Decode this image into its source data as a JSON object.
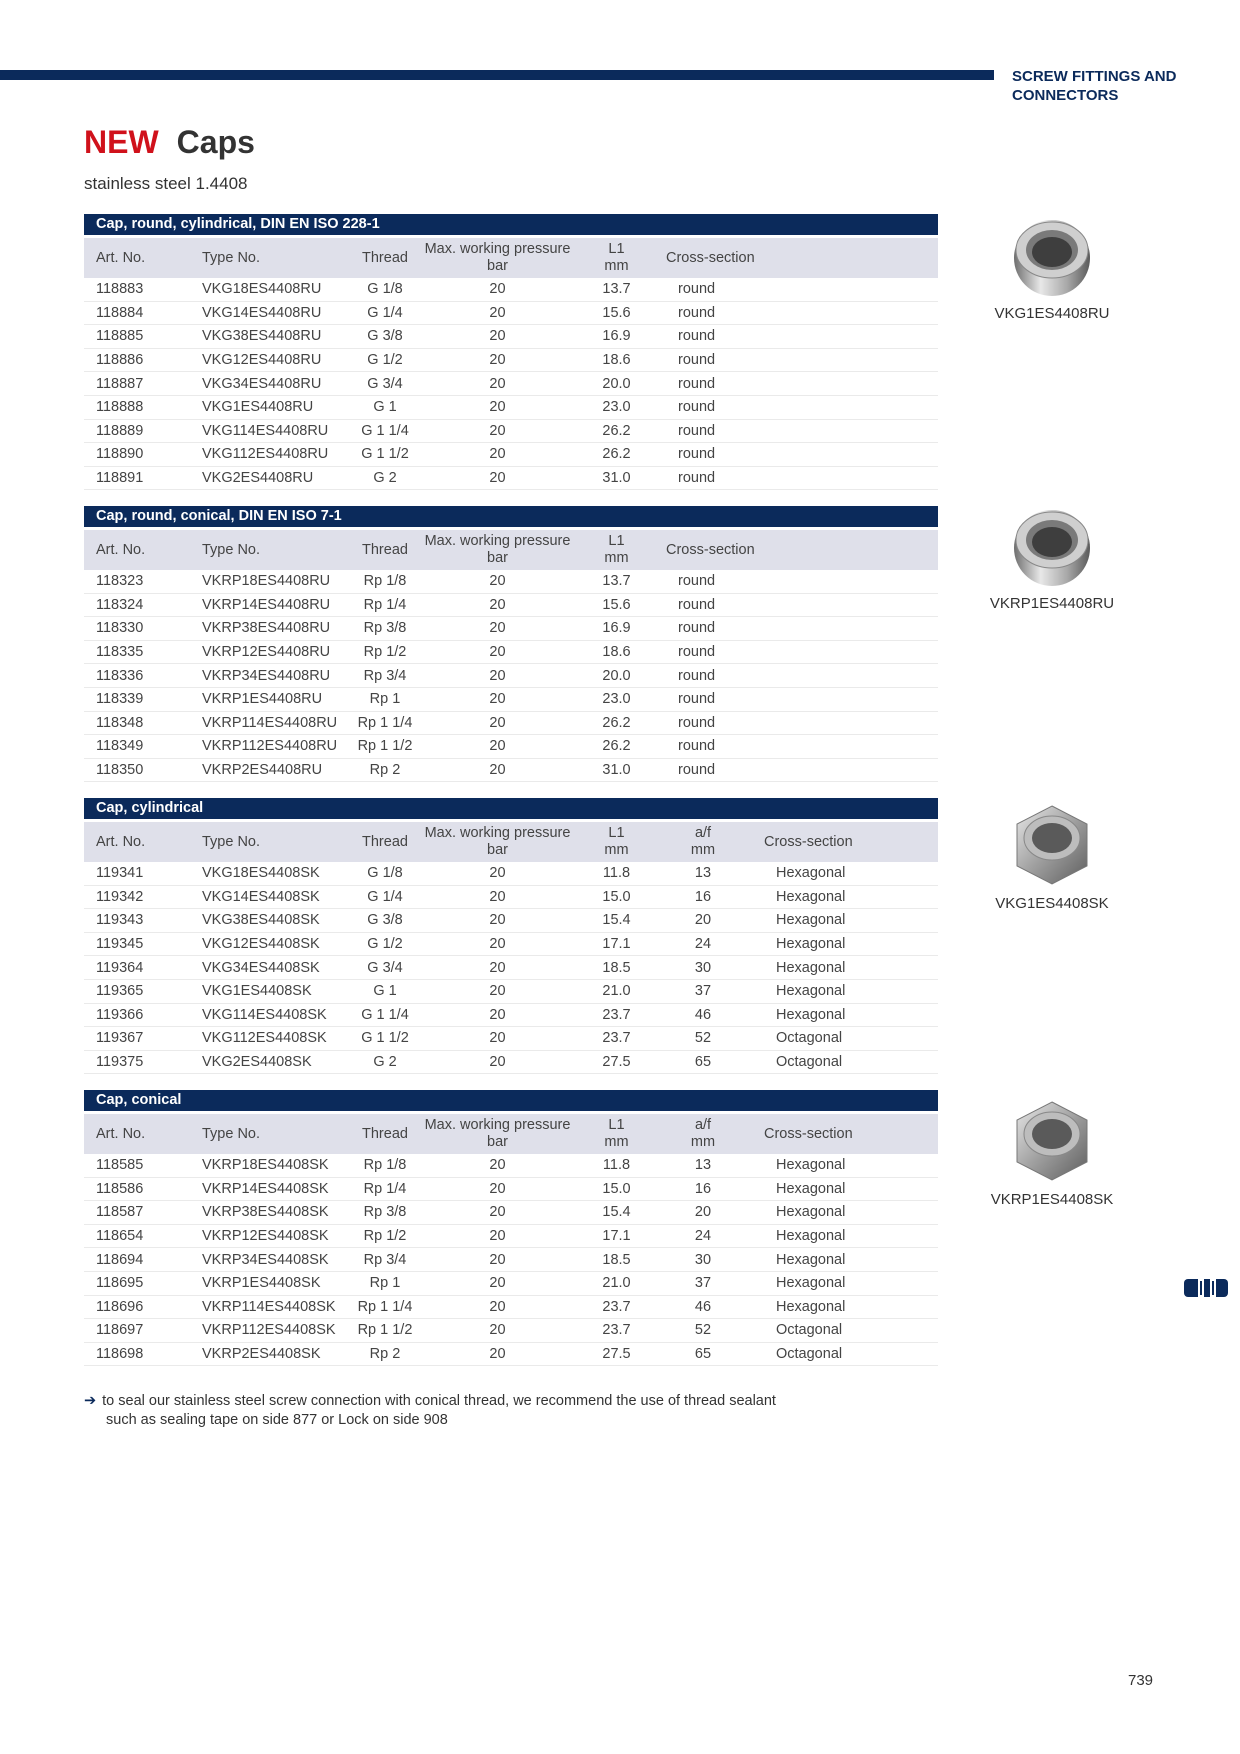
{
  "header": {
    "category": "SCREW FITTINGS AND CONNECTORS"
  },
  "title": {
    "new": "NEW",
    "main": "Caps"
  },
  "subtitle": "stainless steel 1.4408",
  "columns": {
    "art": "Art. No.",
    "type": "Type No.",
    "thread": "Thread",
    "pressure_1": "Max. working pressure",
    "pressure_2": "bar",
    "l1_1": "L1",
    "l1_2": "mm",
    "af_1": "a/f",
    "af_2": "mm",
    "cross": "Cross-section"
  },
  "sections": [
    {
      "title": "Cap, round, cylindrical, DIN EN ISO 228-1",
      "rows": [
        {
          "art": "118883",
          "type": "VKG18ES4408RU",
          "thread": "G 1/8",
          "p": "20",
          "l1": "13.7",
          "cs": "round"
        },
        {
          "art": "118884",
          "type": "VKG14ES4408RU",
          "thread": "G 1/4",
          "p": "20",
          "l1": "15.6",
          "cs": "round"
        },
        {
          "art": "118885",
          "type": "VKG38ES4408RU",
          "thread": "G 3/8",
          "p": "20",
          "l1": "16.9",
          "cs": "round"
        },
        {
          "art": "118886",
          "type": "VKG12ES4408RU",
          "thread": "G 1/2",
          "p": "20",
          "l1": "18.6",
          "cs": "round"
        },
        {
          "art": "118887",
          "type": "VKG34ES4408RU",
          "thread": "G 3/4",
          "p": "20",
          "l1": "20.0",
          "cs": "round"
        },
        {
          "art": "118888",
          "type": "VKG1ES4408RU",
          "thread": "G 1",
          "p": "20",
          "l1": "23.0",
          "cs": "round"
        },
        {
          "art": "118889",
          "type": "VKG114ES4408RU",
          "thread": "G 1 1/4",
          "p": "20",
          "l1": "26.2",
          "cs": "round"
        },
        {
          "art": "118890",
          "type": "VKG112ES4408RU",
          "thread": "G 1 1/2",
          "p": "20",
          "l1": "26.2",
          "cs": "round"
        },
        {
          "art": "118891",
          "type": "VKG2ES4408RU",
          "thread": "G 2",
          "p": "20",
          "l1": "31.0",
          "cs": "round"
        }
      ]
    },
    {
      "title": "Cap, round, conical, DIN EN ISO 7-1",
      "rows": [
        {
          "art": "118323",
          "type": "VKRP18ES4408RU",
          "thread": "Rp 1/8",
          "p": "20",
          "l1": "13.7",
          "cs": "round"
        },
        {
          "art": "118324",
          "type": "VKRP14ES4408RU",
          "thread": "Rp 1/4",
          "p": "20",
          "l1": "15.6",
          "cs": "round"
        },
        {
          "art": "118330",
          "type": "VKRP38ES4408RU",
          "thread": "Rp 3/8",
          "p": "20",
          "l1": "16.9",
          "cs": "round"
        },
        {
          "art": "118335",
          "type": "VKRP12ES4408RU",
          "thread": "Rp 1/2",
          "p": "20",
          "l1": "18.6",
          "cs": "round"
        },
        {
          "art": "118336",
          "type": "VKRP34ES4408RU",
          "thread": "Rp 3/4",
          "p": "20",
          "l1": "20.0",
          "cs": "round"
        },
        {
          "art": "118339",
          "type": "VKRP1ES4408RU",
          "thread": "Rp 1",
          "p": "20",
          "l1": "23.0",
          "cs": "round"
        },
        {
          "art": "118348",
          "type": "VKRP114ES4408RU",
          "thread": "Rp 1 1/4",
          "p": "20",
          "l1": "26.2",
          "cs": "round"
        },
        {
          "art": "118349",
          "type": "VKRP112ES4408RU",
          "thread": "Rp 1 1/2",
          "p": "20",
          "l1": "26.2",
          "cs": "round"
        },
        {
          "art": "118350",
          "type": "VKRP2ES4408RU",
          "thread": "Rp 2",
          "p": "20",
          "l1": "31.0",
          "cs": "round"
        }
      ]
    },
    {
      "title": "Cap, cylindrical",
      "rows": [
        {
          "art": "119341",
          "type": "VKG18ES4408SK",
          "thread": "G 1/8",
          "p": "20",
          "l1": "11.8",
          "af": "13",
          "cs": "Hexagonal"
        },
        {
          "art": "119342",
          "type": "VKG14ES4408SK",
          "thread": "G 1/4",
          "p": "20",
          "l1": "15.0",
          "af": "16",
          "cs": "Hexagonal"
        },
        {
          "art": "119343",
          "type": "VKG38ES4408SK",
          "thread": "G 3/8",
          "p": "20",
          "l1": "15.4",
          "af": "20",
          "cs": "Hexagonal"
        },
        {
          "art": "119345",
          "type": "VKG12ES4408SK",
          "thread": "G 1/2",
          "p": "20",
          "l1": "17.1",
          "af": "24",
          "cs": "Hexagonal"
        },
        {
          "art": "119364",
          "type": "VKG34ES4408SK",
          "thread": "G 3/4",
          "p": "20",
          "l1": "18.5",
          "af": "30",
          "cs": "Hexagonal"
        },
        {
          "art": "119365",
          "type": "VKG1ES4408SK",
          "thread": "G 1",
          "p": "20",
          "l1": "21.0",
          "af": "37",
          "cs": "Hexagonal"
        },
        {
          "art": "119366",
          "type": "VKG114ES4408SK",
          "thread": "G 1 1/4",
          "p": "20",
          "l1": "23.7",
          "af": "46",
          "cs": "Hexagonal"
        },
        {
          "art": "119367",
          "type": "VKG112ES4408SK",
          "thread": "G 1 1/2",
          "p": "20",
          "l1": "23.7",
          "af": "52",
          "cs": "Octagonal"
        },
        {
          "art": "119375",
          "type": "VKG2ES4408SK",
          "thread": "G 2",
          "p": "20",
          "l1": "27.5",
          "af": "65",
          "cs": "Octagonal"
        }
      ]
    },
    {
      "title": "Cap, conical",
      "rows": [
        {
          "art": "118585",
          "type": "VKRP18ES4408SK",
          "thread": "Rp 1/8",
          "p": "20",
          "l1": "11.8",
          "af": "13",
          "cs": "Hexagonal"
        },
        {
          "art": "118586",
          "type": "VKRP14ES4408SK",
          "thread": "Rp 1/4",
          "p": "20",
          "l1": "15.0",
          "af": "16",
          "cs": "Hexagonal"
        },
        {
          "art": "118587",
          "type": "VKRP38ES4408SK",
          "thread": "Rp 3/8",
          "p": "20",
          "l1": "15.4",
          "af": "20",
          "cs": "Hexagonal"
        },
        {
          "art": "118654",
          "type": "VKRP12ES4408SK",
          "thread": "Rp 1/2",
          "p": "20",
          "l1": "17.1",
          "af": "24",
          "cs": "Hexagonal"
        },
        {
          "art": "118694",
          "type": "VKRP34ES4408SK",
          "thread": "Rp 3/4",
          "p": "20",
          "l1": "18.5",
          "af": "30",
          "cs": "Hexagonal"
        },
        {
          "art": "118695",
          "type": "VKRP1ES4408SK",
          "thread": "Rp 1",
          "p": "20",
          "l1": "21.0",
          "af": "37",
          "cs": "Hexagonal"
        },
        {
          "art": "118696",
          "type": "VKRP114ES4408SK",
          "thread": "Rp 1 1/4",
          "p": "20",
          "l1": "23.7",
          "af": "46",
          "cs": "Hexagonal"
        },
        {
          "art": "118697",
          "type": "VKRP112ES4408SK",
          "thread": "Rp 1 1/2",
          "p": "20",
          "l1": "23.7",
          "af": "52",
          "cs": "Octagonal"
        },
        {
          "art": "118698",
          "type": "VKRP2ES4408SK",
          "thread": "Rp 2",
          "p": "20",
          "l1": "27.5",
          "af": "65",
          "cs": "Octagonal"
        }
      ]
    }
  ],
  "products": [
    {
      "label": "VKG1ES4408RU",
      "shape": "round-cap-icon"
    },
    {
      "label": "VKRP1ES4408RU",
      "shape": "round-cap-icon"
    },
    {
      "label": "VKG1ES4408SK",
      "shape": "hex-cap-icon"
    },
    {
      "label": "VKRP1ES4408SK",
      "shape": "hex-cap-icon"
    }
  ],
  "footnote": {
    "line1": "to seal our stainless steel screw connection with conical thread, we recommend the use of thread sealant",
    "line2": "such as sealing tape on side 877 or Lock on side 908"
  },
  "page_number": "739",
  "colors": {
    "brand_navy": "#0b2a5b",
    "accent_red": "#d0111b",
    "header_row": "#dfe0ea"
  }
}
